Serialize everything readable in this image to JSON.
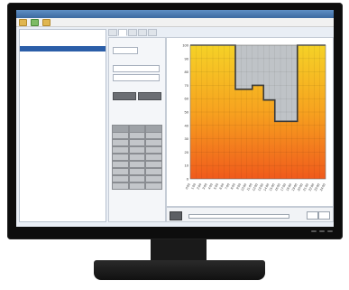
{
  "chart_data": {
    "type": "area",
    "x": [
      0,
      1,
      2,
      3,
      4,
      5,
      6,
      7,
      8,
      9,
      10,
      11,
      12,
      13,
      14,
      15,
      16,
      17,
      18,
      19,
      20,
      21,
      22,
      23,
      24
    ],
    "series": [
      {
        "values": [
          100,
          100,
          100,
          100,
          100,
          100,
          100,
          100,
          67,
          67,
          67,
          70,
          70,
          59,
          59,
          43,
          43,
          43,
          43,
          100,
          100,
          100,
          100,
          100,
          100
        ]
      }
    ],
    "ylim": [
      0,
      100
    ],
    "xlim": [
      0,
      24
    ],
    "grid": true,
    "fill_above": "#bfc3c7",
    "fill_below_gradient": [
      "#f05a1c",
      "#f7a21f",
      "#f5d227"
    ]
  }
}
